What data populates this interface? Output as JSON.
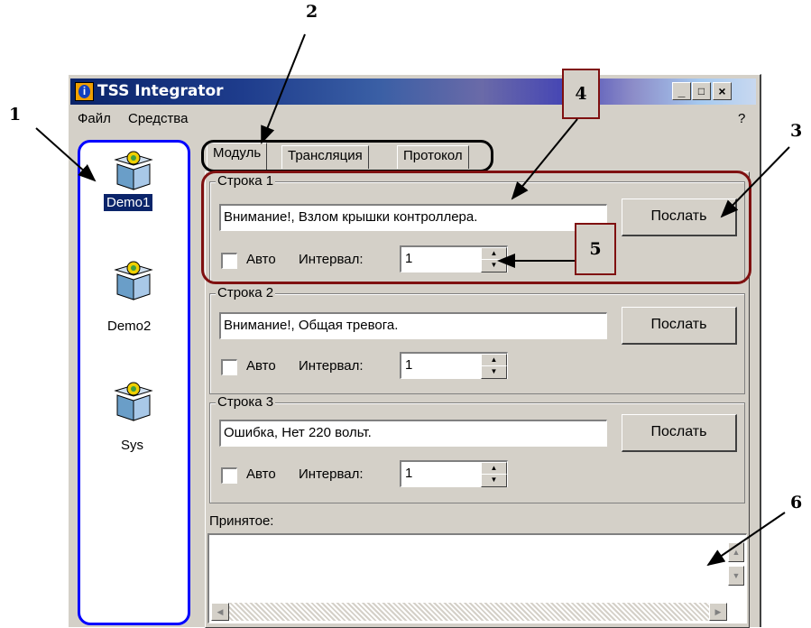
{
  "window": {
    "title": "TSS Integrator",
    "caption_buttons": [
      "_",
      "□",
      "×"
    ]
  },
  "menu": {
    "items": [
      "Файл",
      "Средства"
    ],
    "help": "?"
  },
  "modules": [
    {
      "label": "Demo1",
      "selected": true,
      "icon": "gift-box-icon"
    },
    {
      "label": "Demo2",
      "selected": false,
      "icon": "gift-box-icon"
    },
    {
      "label": "Sys",
      "selected": false,
      "icon": "gift-box-icon"
    }
  ],
  "tabs": [
    {
      "label": "Модуль",
      "active": true
    },
    {
      "label": "Трансляция",
      "active": false
    },
    {
      "label": "Протокол",
      "active": false
    }
  ],
  "rows": [
    {
      "title": "Строка 1",
      "text": "Внимание!, Взлом крышки контроллера.",
      "send_label": "Послать",
      "auto_label": "Авто",
      "auto_checked": false,
      "interval_label": "Интервал:",
      "interval_value": "1"
    },
    {
      "title": "Строка 2",
      "text": "Внимание!, Общая тревога.",
      "send_label": "Послать",
      "auto_label": "Авто",
      "auto_checked": false,
      "interval_label": "Интервал:",
      "interval_value": "1"
    },
    {
      "title": "Строка 3",
      "text": "Ошибка, Нет 220 вольт.",
      "send_label": "Послать",
      "auto_label": "Авто",
      "auto_checked": false,
      "interval_label": "Интервал:",
      "interval_value": "1"
    }
  ],
  "received": {
    "label": "Принятое:",
    "value": ""
  },
  "annotations": [
    "1",
    "2",
    "3",
    "4",
    "5",
    "6"
  ],
  "colors": {
    "module_outline": "#0000ff",
    "tabs_outline": "#000000",
    "highlight": "#7f1010",
    "selection": "#0a246a"
  }
}
